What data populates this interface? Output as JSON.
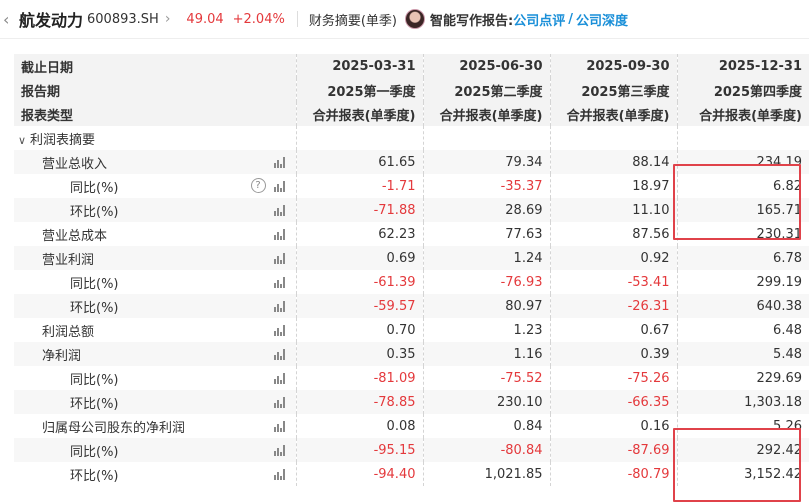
{
  "header": {
    "back_icon": "chevron-left-icon",
    "stock_name": "航发动力",
    "stock_code": "600893.SH",
    "price": "49.04",
    "change_pct": "+2.04%",
    "report_title": "财务摘要(单季)",
    "ai_label": "智能写作报告:",
    "ai_link1": "公司点评",
    "ai_slash": "/",
    "ai_link2": "公司深度"
  },
  "colors": {
    "negative": "#e4393c",
    "link": "#1a8fd8",
    "highlight": "#e0424a"
  },
  "table": {
    "header_rows": [
      {
        "label": "截止日期",
        "values": [
          "2025-03-31",
          "2025-06-30",
          "2025-09-30",
          "2025-12-31"
        ]
      },
      {
        "label": "报告期",
        "values": [
          "2025第一季度",
          "2025第二季度",
          "2025第三季度",
          "2025第四季度"
        ]
      },
      {
        "label": "报表类型",
        "values": [
          "合并报表(单季度)",
          "合并报表(单季度)",
          "合并报表(单季度)",
          "合并报表(单季度)"
        ]
      }
    ],
    "section_label": "利润表摘要",
    "rows": [
      {
        "label": "营业总收入",
        "level": 1,
        "values": [
          "61.65",
          "79.34",
          "88.14",
          "234.19"
        ]
      },
      {
        "label": "同比(%)",
        "level": 2,
        "help": true,
        "values": [
          "-1.71",
          "-35.37",
          "18.97",
          "6.82"
        ]
      },
      {
        "label": "环比(%)",
        "level": 2,
        "values": [
          "-71.88",
          "28.69",
          "11.10",
          "165.71"
        ]
      },
      {
        "label": "营业总成本",
        "level": 1,
        "values": [
          "62.23",
          "77.63",
          "87.56",
          "230.31"
        ]
      },
      {
        "label": "营业利润",
        "level": 1,
        "values": [
          "0.69",
          "1.24",
          "0.92",
          "6.78"
        ]
      },
      {
        "label": "同比(%)",
        "level": 2,
        "values": [
          "-61.39",
          "-76.93",
          "-53.41",
          "299.19"
        ]
      },
      {
        "label": "环比(%)",
        "level": 2,
        "values": [
          "-59.57",
          "80.97",
          "-26.31",
          "640.38"
        ]
      },
      {
        "label": "利润总额",
        "level": 1,
        "values": [
          "0.70",
          "1.23",
          "0.67",
          "6.48"
        ]
      },
      {
        "label": "净利润",
        "level": 1,
        "values": [
          "0.35",
          "1.16",
          "0.39",
          "5.48"
        ]
      },
      {
        "label": "同比(%)",
        "level": 2,
        "values": [
          "-81.09",
          "-75.52",
          "-75.26",
          "229.69"
        ]
      },
      {
        "label": "环比(%)",
        "level": 2,
        "values": [
          "-78.85",
          "230.10",
          "-66.35",
          "1,303.18"
        ]
      },
      {
        "label": "归属母公司股东的净利润",
        "level": 1,
        "values": [
          "0.08",
          "0.84",
          "0.16",
          "5.26"
        ]
      },
      {
        "label": "同比(%)",
        "level": 2,
        "values": [
          "-95.15",
          "-80.84",
          "-87.69",
          "292.42"
        ]
      },
      {
        "label": "环比(%)",
        "level": 2,
        "values": [
          "-94.40",
          "1,021.85",
          "-80.79",
          "3,152.42"
        ]
      }
    ]
  }
}
